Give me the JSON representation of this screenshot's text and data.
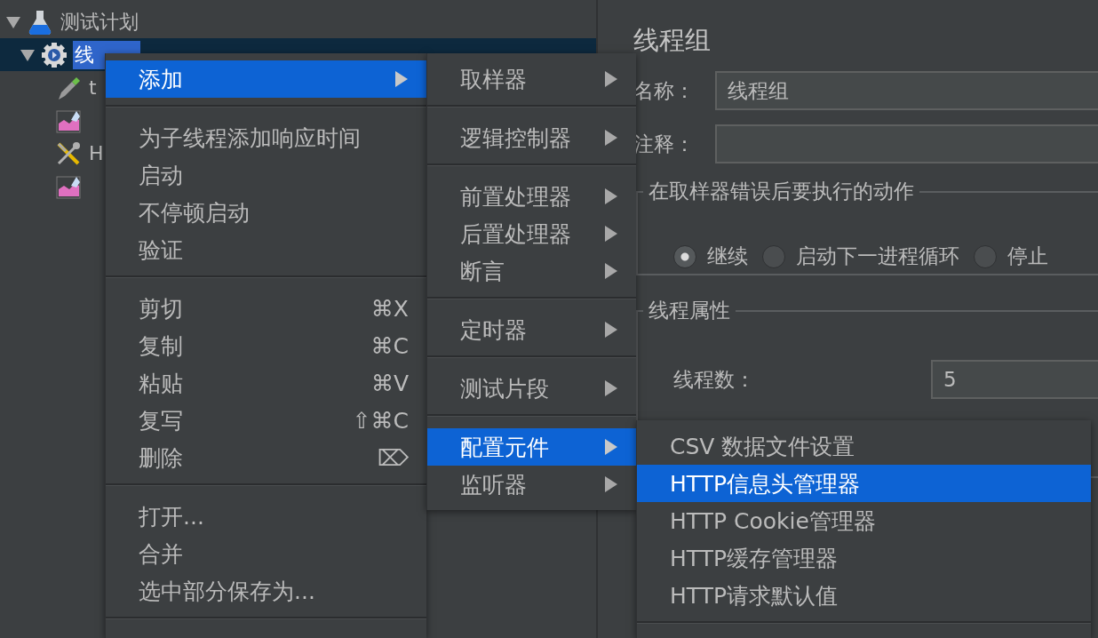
{
  "tree": {
    "items": [
      {
        "label": "测试计划",
        "kind": "plan",
        "expanded": true,
        "selected": false,
        "children": [
          {
            "label": "线",
            "kind": "thread_group",
            "expanded": true,
            "selected": true,
            "children": [
              {
                "label": "t",
                "kind": "sampler",
                "selected": false
              },
              {
                "kind": "listener",
                "selected": false
              },
              {
                "label": "H",
                "kind": "config",
                "selected": false
              },
              {
                "kind": "listener",
                "selected": false
              }
            ]
          }
        ]
      }
    ]
  },
  "editor": {
    "title": "线程组",
    "fields": [
      {
        "label": "名称：",
        "value": "线程组"
      },
      {
        "label": "注释："
      }
    ],
    "error_action": {
      "title": "在取样器错误后要执行的动作",
      "options": [
        {
          "label": "继续",
          "selected": true
        },
        {
          "label": "启动下一进程循环",
          "selected": false
        },
        {
          "label": "停止",
          "selected": false
        }
      ]
    },
    "thread_properties": {
      "title": "线程属性",
      "fields": [
        {
          "label": "线程数：",
          "value": "5"
        }
      ]
    }
  },
  "context_menu": {
    "items": [
      {
        "kind": "item",
        "label": "添加",
        "selected": true,
        "submenu": true
      },
      {
        "kind": "separator"
      },
      {
        "kind": "item",
        "label": "为子线程添加响应时间",
        "selected": false
      },
      {
        "kind": "item",
        "label": "启动",
        "selected": false
      },
      {
        "kind": "item",
        "label": "不停顿启动",
        "selected": false
      },
      {
        "kind": "item",
        "label": "验证",
        "selected": false
      },
      {
        "kind": "separator"
      },
      {
        "kind": "item",
        "label": "剪切",
        "shortcut": "⌘X",
        "selected": false
      },
      {
        "kind": "item",
        "label": "复制",
        "shortcut": "⌘C",
        "selected": false
      },
      {
        "kind": "item",
        "label": "粘贴",
        "shortcut": "⌘V",
        "selected": false
      },
      {
        "kind": "item",
        "label": "复写",
        "shortcut": "⇧⌘C",
        "selected": false
      },
      {
        "kind": "item",
        "label": "删除",
        "shortcut": "⌦",
        "selected": false
      },
      {
        "kind": "separator"
      },
      {
        "kind": "item",
        "label": "打开...",
        "selected": false
      },
      {
        "kind": "item",
        "label": "合并",
        "selected": false
      },
      {
        "kind": "item",
        "label": "选中部分保存为...",
        "selected": false
      },
      {
        "kind": "separator"
      }
    ]
  },
  "add_submenu": {
    "items": [
      {
        "kind": "item",
        "label": "取样器",
        "selected": false,
        "submenu": true
      },
      {
        "kind": "separator"
      },
      {
        "kind": "item",
        "label": "逻辑控制器",
        "selected": false,
        "submenu": true
      },
      {
        "kind": "separator"
      },
      {
        "kind": "item",
        "label": "前置处理器",
        "selected": false,
        "submenu": true
      },
      {
        "kind": "item",
        "label": "后置处理器",
        "selected": false,
        "submenu": true
      },
      {
        "kind": "item",
        "label": "断言",
        "selected": false,
        "submenu": true
      },
      {
        "kind": "separator"
      },
      {
        "kind": "item",
        "label": "定时器",
        "selected": false,
        "submenu": true
      },
      {
        "kind": "separator"
      },
      {
        "kind": "item",
        "label": "测试片段",
        "selected": false,
        "submenu": true
      },
      {
        "kind": "separator"
      },
      {
        "kind": "item",
        "label": "配置元件",
        "selected": true,
        "submenu": true
      },
      {
        "kind": "item",
        "label": "监听器",
        "selected": false,
        "submenu": true
      }
    ]
  },
  "config_submenu": {
    "items": [
      {
        "kind": "item",
        "label": "CSV 数据文件设置",
        "selected": false
      },
      {
        "kind": "item",
        "label": "HTTP信息头管理器",
        "selected": true
      },
      {
        "kind": "item",
        "label": "HTTP Cookie管理器",
        "selected": false
      },
      {
        "kind": "item",
        "label": "HTTP缓存管理器",
        "selected": false
      },
      {
        "kind": "item",
        "label": "HTTP请求默认值",
        "selected": false
      },
      {
        "kind": "separator"
      }
    ]
  }
}
